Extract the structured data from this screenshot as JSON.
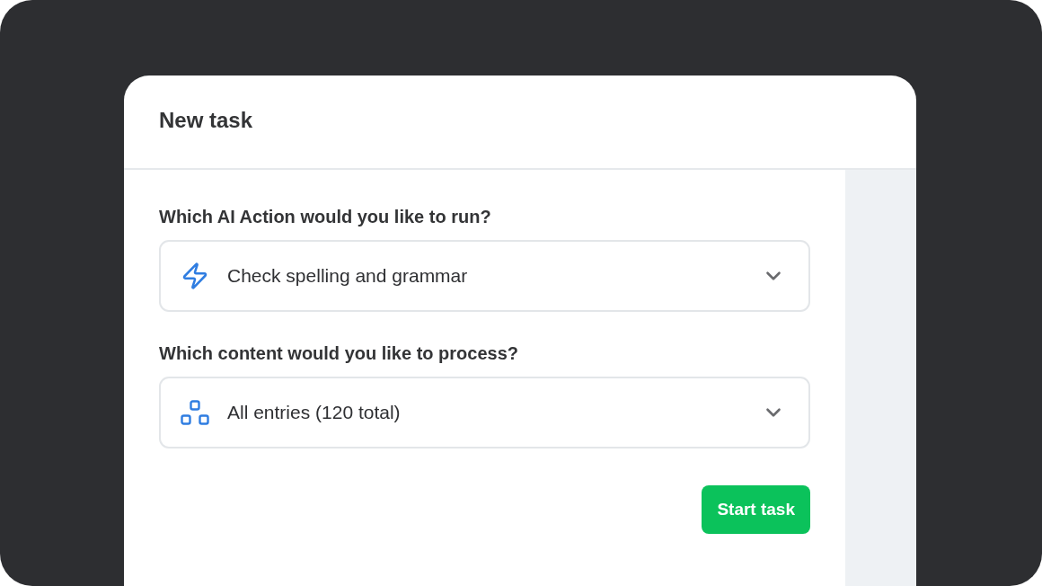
{
  "dialog": {
    "title": "New task"
  },
  "fields": [
    {
      "kind": "action",
      "label": "Which AI Action would you like to run?",
      "value": "Check spelling and grammar"
    },
    {
      "kind": "content",
      "label": "Which content would you like to process?",
      "value": "All entries (120 total)"
    }
  ],
  "buttons": [
    {
      "label": "Start task"
    }
  ]
}
